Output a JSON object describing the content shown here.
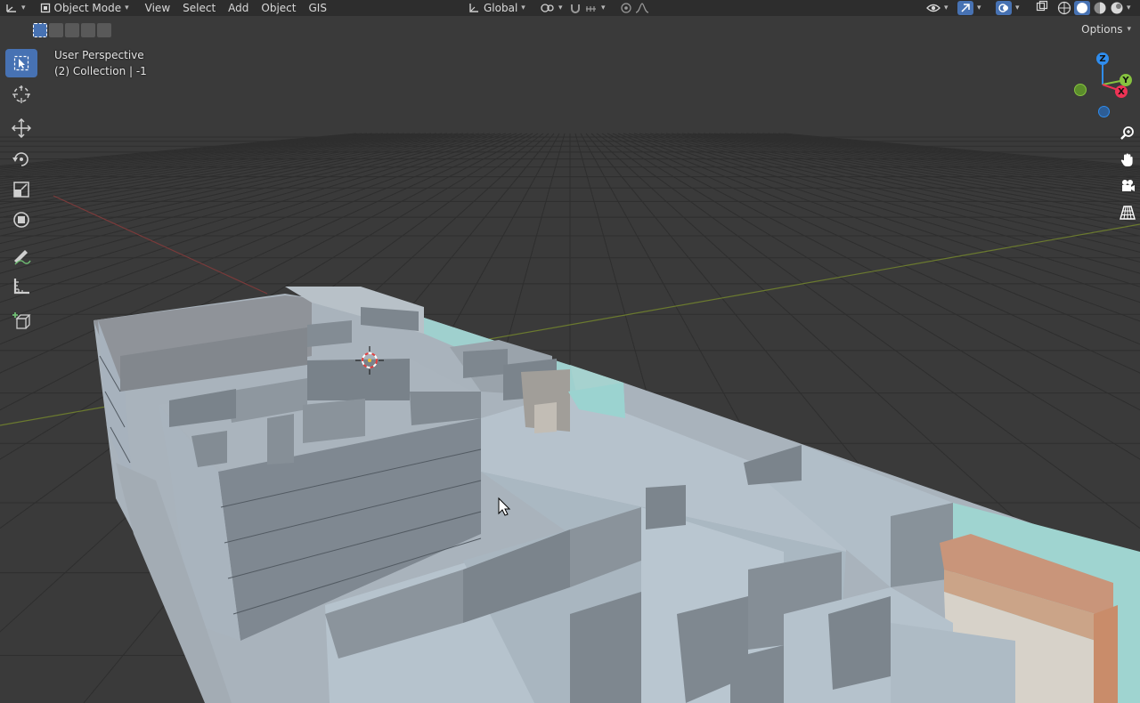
{
  "header": {
    "mode_label": "Object Mode",
    "menus": [
      "View",
      "Select",
      "Add",
      "Object",
      "GIS"
    ],
    "orientation_label": "Global",
    "options_label": "Options"
  },
  "overlay": {
    "perspective_label": "User Perspective",
    "collection_label": "(2) Collection | -1"
  },
  "gizmo": {
    "z_label": "Z",
    "y_label": "Y",
    "x_label": "X"
  },
  "colors": {
    "accent": "#4772b3",
    "x_axis": "#ee3355",
    "y_axis": "#86c33f",
    "z_axis": "#2f8dee",
    "header_bg": "#2d2d2d",
    "viewport_bg": "#3a3a3a"
  },
  "toolbar": {
    "tools": [
      "select-box",
      "cursor",
      "move",
      "rotate",
      "scale",
      "transform",
      "annotate",
      "measure",
      "add-cube"
    ],
    "active_tool": "select-box"
  },
  "navigation": {
    "buttons": [
      "zoom",
      "pan",
      "camera",
      "ortho-grid"
    ]
  }
}
